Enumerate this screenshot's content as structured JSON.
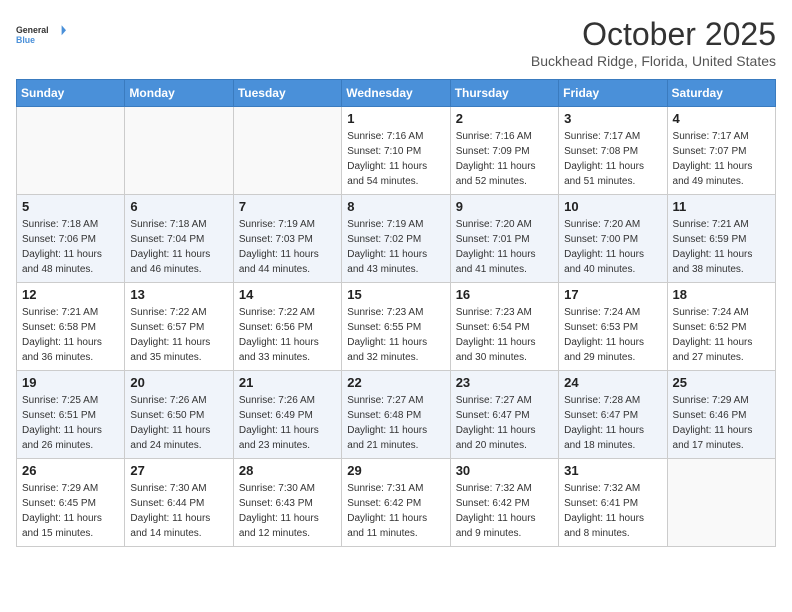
{
  "header": {
    "logo_line1": "General",
    "logo_line2": "Blue",
    "title": "October 2025",
    "location": "Buckhead Ridge, Florida, United States"
  },
  "columns": [
    "Sunday",
    "Monday",
    "Tuesday",
    "Wednesday",
    "Thursday",
    "Friday",
    "Saturday"
  ],
  "weeks": [
    [
      {
        "day": "",
        "info": ""
      },
      {
        "day": "",
        "info": ""
      },
      {
        "day": "",
        "info": ""
      },
      {
        "day": "1",
        "info": "Sunrise: 7:16 AM\nSunset: 7:10 PM\nDaylight: 11 hours\nand 54 minutes."
      },
      {
        "day": "2",
        "info": "Sunrise: 7:16 AM\nSunset: 7:09 PM\nDaylight: 11 hours\nand 52 minutes."
      },
      {
        "day": "3",
        "info": "Sunrise: 7:17 AM\nSunset: 7:08 PM\nDaylight: 11 hours\nand 51 minutes."
      },
      {
        "day": "4",
        "info": "Sunrise: 7:17 AM\nSunset: 7:07 PM\nDaylight: 11 hours\nand 49 minutes."
      }
    ],
    [
      {
        "day": "5",
        "info": "Sunrise: 7:18 AM\nSunset: 7:06 PM\nDaylight: 11 hours\nand 48 minutes."
      },
      {
        "day": "6",
        "info": "Sunrise: 7:18 AM\nSunset: 7:04 PM\nDaylight: 11 hours\nand 46 minutes."
      },
      {
        "day": "7",
        "info": "Sunrise: 7:19 AM\nSunset: 7:03 PM\nDaylight: 11 hours\nand 44 minutes."
      },
      {
        "day": "8",
        "info": "Sunrise: 7:19 AM\nSunset: 7:02 PM\nDaylight: 11 hours\nand 43 minutes."
      },
      {
        "day": "9",
        "info": "Sunrise: 7:20 AM\nSunset: 7:01 PM\nDaylight: 11 hours\nand 41 minutes."
      },
      {
        "day": "10",
        "info": "Sunrise: 7:20 AM\nSunset: 7:00 PM\nDaylight: 11 hours\nand 40 minutes."
      },
      {
        "day": "11",
        "info": "Sunrise: 7:21 AM\nSunset: 6:59 PM\nDaylight: 11 hours\nand 38 minutes."
      }
    ],
    [
      {
        "day": "12",
        "info": "Sunrise: 7:21 AM\nSunset: 6:58 PM\nDaylight: 11 hours\nand 36 minutes."
      },
      {
        "day": "13",
        "info": "Sunrise: 7:22 AM\nSunset: 6:57 PM\nDaylight: 11 hours\nand 35 minutes."
      },
      {
        "day": "14",
        "info": "Sunrise: 7:22 AM\nSunset: 6:56 PM\nDaylight: 11 hours\nand 33 minutes."
      },
      {
        "day": "15",
        "info": "Sunrise: 7:23 AM\nSunset: 6:55 PM\nDaylight: 11 hours\nand 32 minutes."
      },
      {
        "day": "16",
        "info": "Sunrise: 7:23 AM\nSunset: 6:54 PM\nDaylight: 11 hours\nand 30 minutes."
      },
      {
        "day": "17",
        "info": "Sunrise: 7:24 AM\nSunset: 6:53 PM\nDaylight: 11 hours\nand 29 minutes."
      },
      {
        "day": "18",
        "info": "Sunrise: 7:24 AM\nSunset: 6:52 PM\nDaylight: 11 hours\nand 27 minutes."
      }
    ],
    [
      {
        "day": "19",
        "info": "Sunrise: 7:25 AM\nSunset: 6:51 PM\nDaylight: 11 hours\nand 26 minutes."
      },
      {
        "day": "20",
        "info": "Sunrise: 7:26 AM\nSunset: 6:50 PM\nDaylight: 11 hours\nand 24 minutes."
      },
      {
        "day": "21",
        "info": "Sunrise: 7:26 AM\nSunset: 6:49 PM\nDaylight: 11 hours\nand 23 minutes."
      },
      {
        "day": "22",
        "info": "Sunrise: 7:27 AM\nSunset: 6:48 PM\nDaylight: 11 hours\nand 21 minutes."
      },
      {
        "day": "23",
        "info": "Sunrise: 7:27 AM\nSunset: 6:47 PM\nDaylight: 11 hours\nand 20 minutes."
      },
      {
        "day": "24",
        "info": "Sunrise: 7:28 AM\nSunset: 6:47 PM\nDaylight: 11 hours\nand 18 minutes."
      },
      {
        "day": "25",
        "info": "Sunrise: 7:29 AM\nSunset: 6:46 PM\nDaylight: 11 hours\nand 17 minutes."
      }
    ],
    [
      {
        "day": "26",
        "info": "Sunrise: 7:29 AM\nSunset: 6:45 PM\nDaylight: 11 hours\nand 15 minutes."
      },
      {
        "day": "27",
        "info": "Sunrise: 7:30 AM\nSunset: 6:44 PM\nDaylight: 11 hours\nand 14 minutes."
      },
      {
        "day": "28",
        "info": "Sunrise: 7:30 AM\nSunset: 6:43 PM\nDaylight: 11 hours\nand 12 minutes."
      },
      {
        "day": "29",
        "info": "Sunrise: 7:31 AM\nSunset: 6:42 PM\nDaylight: 11 hours\nand 11 minutes."
      },
      {
        "day": "30",
        "info": "Sunrise: 7:32 AM\nSunset: 6:42 PM\nDaylight: 11 hours\nand 9 minutes."
      },
      {
        "day": "31",
        "info": "Sunrise: 7:32 AM\nSunset: 6:41 PM\nDaylight: 11 hours\nand 8 minutes."
      },
      {
        "day": "",
        "info": ""
      }
    ]
  ]
}
